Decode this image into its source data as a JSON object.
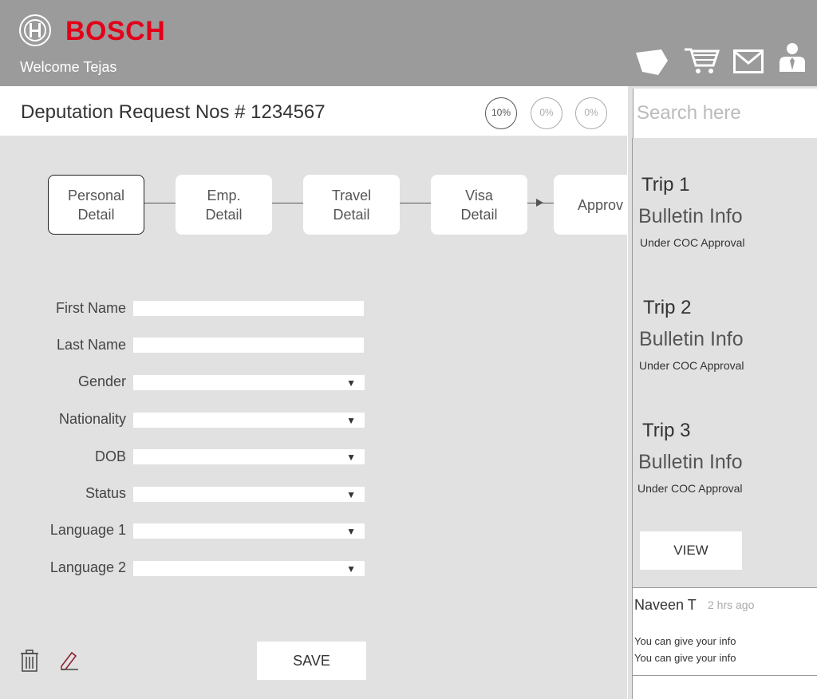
{
  "header": {
    "brand": "BOSCH",
    "welcome": "Welcome Tejas",
    "icons": [
      "bosch-logo-icon",
      "tag-icon",
      "cart-icon",
      "mail-icon",
      "user-icon"
    ]
  },
  "title": {
    "text": "Deputation Request Nos # 1234567",
    "progress": [
      "10%",
      "0%",
      "0%"
    ]
  },
  "steps": [
    {
      "line1": "Personal",
      "line2": "Detail"
    },
    {
      "line1": "Emp.",
      "line2": "Detail"
    },
    {
      "line1": "Travel",
      "line2": "Detail"
    },
    {
      "line1": "Visa",
      "line2": "Detail"
    },
    {
      "line1": "Approv",
      "line2": ""
    }
  ],
  "form": {
    "first_name": "First Name",
    "last_name": "Last Name",
    "gender": "Gender",
    "nationality": "Nationality",
    "dob": "DOB",
    "status": "Status",
    "language1": "Language 1",
    "language2": "Language 2",
    "caret": "▼",
    "save": "SAVE"
  },
  "sidebar": {
    "search_placeholder": "Search here",
    "trips": [
      {
        "title": "Trip 1",
        "info": "Bulletin Info",
        "status": "Under COC Approval"
      },
      {
        "title": "Trip 2",
        "info": "Bulletin Info",
        "status": "Under COC Approval"
      },
      {
        "title": "Trip 3",
        "info": "Bulletin Info",
        "status": "Under COC Approval"
      }
    ],
    "view": "VIEW",
    "comment": {
      "author": "Naveen T",
      "time": "2 hrs ago",
      "lines": [
        "You can give your info",
        "You can give your info"
      ]
    }
  },
  "colors": {
    "header_bg": "#9b9b9b",
    "brand_red": "#e2001a",
    "page_bg": "#e1e1e1"
  }
}
